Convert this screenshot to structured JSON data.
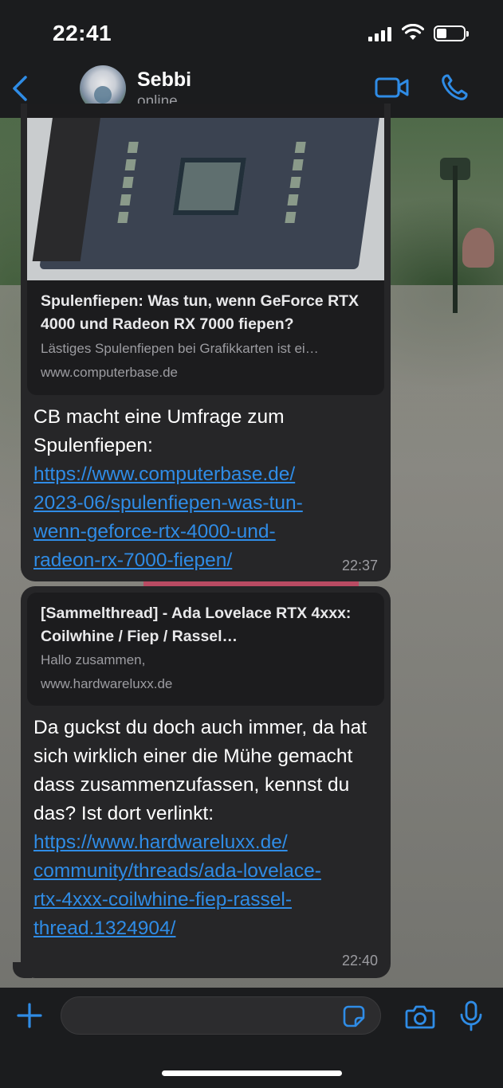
{
  "status_bar": {
    "time": "22:41"
  },
  "header": {
    "name": "Sebbi",
    "status": "online"
  },
  "messages": [
    {
      "preview": {
        "title": "Spulenfiepen: Was tun, wenn GeForce RTX 4000 und Radeon RX 7000 fiepen?",
        "description": "Lästiges Spulenfiepen bei Grafikkarten ist ei…",
        "domain": "www.computerbase.de"
      },
      "text": "CB macht eine Umfrage zum Spulenfiepen:",
      "link_lines": [
        "https://www.computerbase.de/",
        "2023-06/spulenfiepen-was-tun-",
        "wenn-geforce-rtx-4000-und-",
        "radeon-rx-7000-fiepen/"
      ],
      "time": "22:37"
    },
    {
      "preview": {
        "title": "[Sammelthread] - Ada Lovelace RTX 4xxx: Coilwhine / Fiep / Rassel…",
        "description": "Hallo zusammen,",
        "domain": "www.hardwareluxx.de"
      },
      "text": "Da guckst du doch auch immer, da hat sich wirklich einer die Mühe gemacht dass zusammenzufassen, kennst du das? Ist dort verlinkt:",
      "link_lines": [
        "https://www.hardwareluxx.de/",
        "community/threads/ada-lovelace-",
        "rtx-4xxx-coilwhine-fiep-rassel-",
        "thread.1324904/"
      ],
      "time": "22:40"
    }
  ],
  "icons": [
    "back-icon",
    "video-call-icon",
    "phone-icon",
    "plus-icon",
    "sticker-icon",
    "camera-icon",
    "microphone-icon"
  ],
  "colors": {
    "accent": "#2f8ce6",
    "bubble": "#262628",
    "background": "#1b1c1e"
  }
}
